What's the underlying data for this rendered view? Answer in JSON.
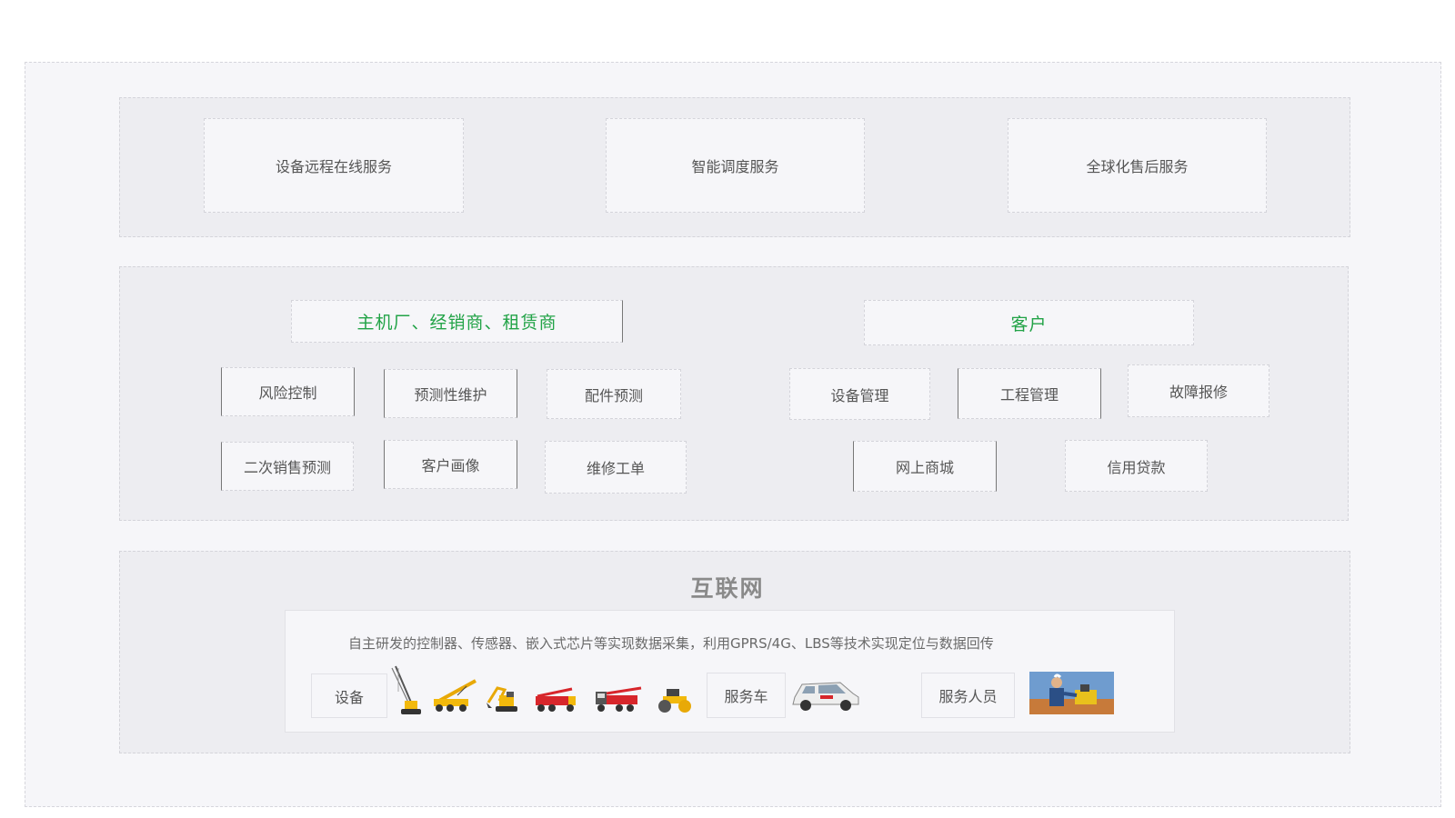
{
  "top_services": [
    {
      "label": "设备远程在线服务"
    },
    {
      "label": "智能调度服务"
    },
    {
      "label": "全球化售后服务"
    }
  ],
  "middle": {
    "left": {
      "title": "主机厂、经销商、租赁商",
      "items": [
        {
          "label": "风险控制"
        },
        {
          "label": "预测性维护"
        },
        {
          "label": "配件预测"
        },
        {
          "label": "二次销售预测"
        },
        {
          "label": "客户画像"
        },
        {
          "label": "维修工单"
        }
      ]
    },
    "right": {
      "title": "客户",
      "items": [
        {
          "label": "设备管理"
        },
        {
          "label": "工程管理"
        },
        {
          "label": "故障报修"
        },
        {
          "label": "网上商城"
        },
        {
          "label": "信用贷款"
        }
      ]
    }
  },
  "internet": {
    "title": "互联网",
    "description": "自主研发的控制器、传感器、嵌入式芯片等实现数据采集，利用GPRS/4G、LBS等技术实现定位与数据回传",
    "equipment_label": "设备",
    "service_vehicle_label": "服务车",
    "service_staff_label": "服务人员",
    "equipment_icons": [
      "crawler-crane-icon",
      "truck-crane-icon",
      "excavator-icon",
      "pump-truck-icon",
      "concrete-pump-truck-icon",
      "road-roller-icon"
    ],
    "vehicle_icon": "service-suv-icon",
    "staff_icon": "service-technician-icon"
  },
  "colors": {
    "accent_green": "#22a347",
    "panel_bg": "#ededf1",
    "box_bg": "#f6f6f9",
    "machinery_yellow": "#f2b90c",
    "truck_red": "#d7262b"
  }
}
